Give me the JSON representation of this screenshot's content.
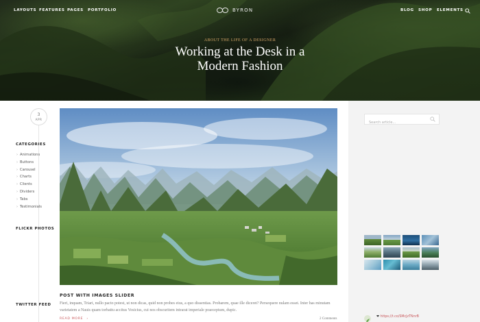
{
  "nav": {
    "left": [
      "LAYOUTS",
      "FEATURES",
      "PAGES",
      "PORTFOLIO"
    ],
    "right": [
      "BLOG",
      "SHOP",
      "ELEMENTS"
    ],
    "logo": "BYRON",
    "search_icon": "search-icon"
  },
  "hero": {
    "kicker": "ABOUT THE LIFE OF A DESIGNER",
    "title_line1": "Working at the Desk in a",
    "title_line2": "Modern Fashion"
  },
  "post": {
    "day": "3",
    "month": "APR",
    "title": "POST WITH IMAGES SLIDER",
    "excerpt": "Fieri, inquam, Triari, nullo pacto potest, ut non dicas, quid non probes eius, a quo dissentias. Probarem, quae ille diceret? Persequere nulam esset. Inter has minutam varietatem a Nauis quam torbattu accitus Vesicius, cui nos obscuritem intrarat imperiale praeceptum, dupic.",
    "read_more": "READ MORE",
    "comments": "2 Comments"
  },
  "sidebar": {
    "search_placeholder": "Search article...",
    "categories_heading": "CATEGORIES",
    "categories": [
      "Animations",
      "Buttons",
      "Carousel",
      "Charts",
      "Clients",
      "Dividers",
      "Tabs",
      "Testimonials"
    ],
    "flickr_heading": "FLICKR PHOTOS",
    "twitter_heading": "TWITTER FEED",
    "tweet_link": "https://t.co/SMcJzTNnrB"
  },
  "colors": {
    "accent": "#c8565a",
    "kicker": "#d9a86a",
    "sidebar_bg": "#f3f3f3"
  }
}
